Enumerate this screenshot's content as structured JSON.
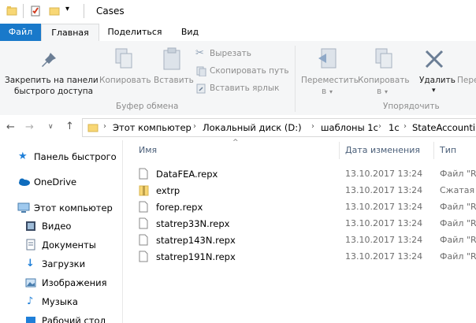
{
  "window": {
    "title": "Cases"
  },
  "ribbon_tabs": [
    {
      "label": "Файл"
    },
    {
      "label": "Главная"
    },
    {
      "label": "Поделиться"
    },
    {
      "label": "Вид"
    }
  ],
  "ribbon": {
    "pin_label_1": "Закрепить на панели",
    "pin_label_2": "быстрого доступа",
    "copy_label": "Копировать",
    "paste_label": "Вставить",
    "cut_label": "Вырезать",
    "copy_path_label": "Скопировать путь",
    "paste_shortcut_label": "Вставить ярлык",
    "clipboard_group": "Буфер обмена",
    "move_label_1": "Переместить",
    "move_label_2": "в",
    "copyto_label_1": "Копировать",
    "copyto_label_2": "в",
    "delete_label": "Удалить",
    "rename_label": "Пере",
    "organize_group": "Упорядочить"
  },
  "address": {
    "crumbs": [
      "Этот компьютер",
      "Локальный диск (D:)",
      "шаблоны 1с",
      "1с",
      "StateAccounting"
    ]
  },
  "nav": {
    "quick_access": "Панель быстрого",
    "onedrive": "OneDrive",
    "this_pc": "Этот компьютер",
    "video": "Видео",
    "documents": "Документы",
    "downloads": "Загрузки",
    "pictures": "Изображения",
    "music": "Музыка",
    "desktop": "Рабочий стол"
  },
  "columns": {
    "name": "Имя",
    "date": "Дата изменения",
    "type": "Тип"
  },
  "files": [
    {
      "name": "DataFEA.repx",
      "date": "13.10.2017 13:24",
      "type": "Файл \"RE"
    },
    {
      "name": "extrp",
      "date": "13.10.2017 13:24",
      "type": "Сжатая Z"
    },
    {
      "name": "forep.repx",
      "date": "13.10.2017 13:24",
      "type": "Файл \"RE"
    },
    {
      "name": "statrep33N.repx",
      "date": "13.10.2017 13:24",
      "type": "Файл \"RE"
    },
    {
      "name": "statrep143N.repx",
      "date": "13.10.2017 13:24",
      "type": "Файл \"RE"
    },
    {
      "name": "statrep191N.repx",
      "date": "13.10.2017 13:24",
      "type": "Файл \"RE"
    }
  ]
}
